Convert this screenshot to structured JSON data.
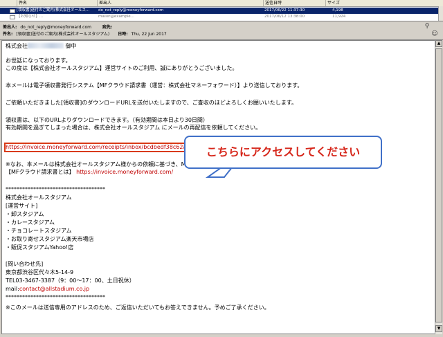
{
  "message_list": {
    "columns": [
      "件名",
      "差出人",
      "送信日時",
      "サイズ"
    ],
    "selected_row": {
      "subject": "[領収書]送付のご案内(株式会社オールス...",
      "sender": "do_not_reply@moneyforward.com",
      "date": "2017/06/22 11:37:30",
      "size": "4,198"
    },
    "faded_row": {
      "subject": "【お知らせ】...",
      "sender": "mailer@example...",
      "date": "2017/06/12 13:38:00",
      "size": "11,924"
    }
  },
  "header": {
    "from_label": "差出人:",
    "from_value": "do_not_reply@moneyforward.com",
    "to_label": "宛先:",
    "subject_label": "件名:",
    "subject_value": "[領収書]送付のご案内(株式会社オールスタジアム)",
    "date_label": "日時:",
    "date_value": "Thu, 22 Jun 2017"
  },
  "body": {
    "addressee_prefix": "株式会社",
    "addressee_suffix": "御中",
    "l1": "お世話になっております。",
    "l2": "この度は【株式会社オールスタジアム】運営サイトのご利用、誠にありがとうございました。",
    "l3": "本メールは電子領収書発行システム【MFクラウド請求書（運営：株式会社マネーフォワード）】より送信しております。",
    "l4": "ご依頼いただきました[領収書]のダウンロードURLを送付いたしますので、ご査収のほどよろしくお願いいたします。",
    "l5": "領収書は、以下のURLよりダウンロードできます。（有効期間は本日より30日間）",
    "l6": "有効期間を過ぎてしまった場合は、株式会社オールスタジアム にメールの再配信を依頼してください。",
    "receipt_url": "https://invoice.moneyforward.com/receipts/inbox/bcdbedf38c62a390ae841849b2151dc57fd3dab8",
    "note1": "※なお、本メールは株式会社オールスタジアム様からの依頼に基づき、MFクラウド請求書にてお送りしております。",
    "note2_label": "【MFクラウド請求書とは】",
    "note2_url": "https://invoice.moneyforward.com/",
    "separator": "************************************",
    "sig_company": "株式会社オールスタジアム",
    "sig_ops": "[運営サイト]",
    "sig_site1": "・卸スタジアム",
    "sig_site2": "・カレースタジアム",
    "sig_site3": "・チョコレートスタジアム",
    "sig_site4": "・お取り寄せスタジアム楽天市場店",
    "sig_site5": "・販促スタジアムYahoo!店",
    "contact_label": "[問い合わせ先]",
    "address": "東京都渋谷区代々木5-14-9",
    "tel": "TEL03-3467-3387（9：00～17：00、土日祝休）",
    "mail_label": "mail:",
    "mail_value": "contact@allstadium.co.jp",
    "separator2": "************************************",
    "footer": "※このメールは送信専用のアドレスのため、ご返信いただいてもお答えできません。予めご了承ください。"
  },
  "annotation": {
    "callout_text": "こちらにアクセスしてください",
    "box_color": "#d93a16",
    "callout_border": "#4070c8",
    "callout_text_color": "#d6261a"
  },
  "colors": {
    "link": "#c00000",
    "selection": "#0a246a",
    "chrome": "#d4d0c8"
  },
  "icons": {
    "attachment": "paperclip-icon",
    "people": "contacts-icon",
    "person": "person-icon"
  }
}
